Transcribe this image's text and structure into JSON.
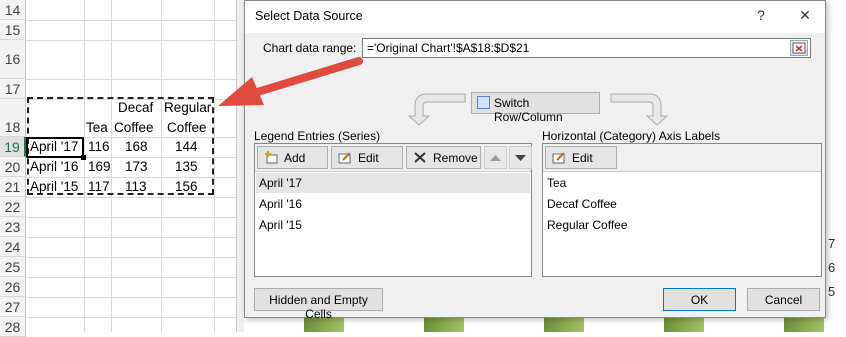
{
  "sheet": {
    "row_numbers": [
      "14",
      "15",
      "16",
      "17",
      "18",
      "19",
      "20",
      "21",
      "22",
      "23",
      "24",
      "25",
      "26",
      "27",
      "28"
    ],
    "headers": {
      "b": "Tea",
      "c1": "Decaf",
      "c2": "Coffee",
      "d1": "Regular",
      "d2": "Coffee"
    },
    "rows": [
      {
        "a": "April '17",
        "b": "116",
        "c": "168",
        "d": "144"
      },
      {
        "a": "April '16",
        "b": "169",
        "c": "173",
        "d": "135"
      },
      {
        "a": "April '15",
        "b": "117",
        "c": "113",
        "d": "156"
      }
    ],
    "right_digits": [
      "7",
      "6",
      "5"
    ]
  },
  "dialog": {
    "title": "Select Data Source",
    "help": "?",
    "close": "✕",
    "range_label": "Chart data range:",
    "range_value": "='Original Chart'!$A$18:$D$21",
    "switch_label": "Switch Row/Column",
    "legend_title": "Legend Entries (Series)",
    "legend_buttons": {
      "add": "Add",
      "edit": "Edit",
      "remove": "Remove"
    },
    "series": [
      "April '17",
      "April '16",
      "April '15"
    ],
    "axis_title": "Horizontal (Category) Axis Labels",
    "axis_edit": "Edit",
    "categories": [
      "Tea",
      "Decaf Coffee",
      "Regular Coffee"
    ],
    "hidden_cells": "Hidden and Empty Cells",
    "ok": "OK",
    "cancel": "Cancel"
  },
  "colors": {
    "accent": "#217346",
    "arrow": "#e04a3f",
    "selection": "#0078d7"
  }
}
